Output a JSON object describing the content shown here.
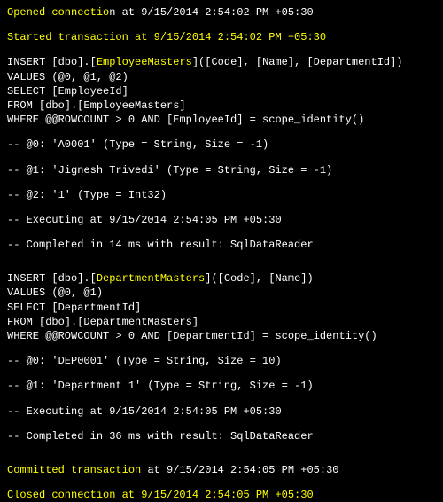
{
  "lines": {
    "opened_pre": "Opened connectio",
    "opened_rest": "n at 9/15/2014 2:54:02 PM +05:30",
    "started": "Started transaction at 9/15/2014 2:54:02 PM +05:30",
    "ins1_pre": "INSERT [dbo].[",
    "ins1_tbl": "EmployeeMasters",
    "ins1_post": "]([Code], [Name], [DepartmentId])",
    "values1": "VALUES (@0, @1, @2)",
    "select1": "SELECT [EmployeeId]",
    "from1": "FROM [dbo].[EmployeeMasters]",
    "where1": "WHERE @@ROWCOUNT > 0 AND [EmployeeId] = scope_identity()",
    "p0_1": "-- @0: 'A0001' (Type = String, Size = -1)",
    "p1_1": "-- @1: 'Jignesh Trivedi' (Type = String, Size = -1)",
    "p2_1": "-- @2: '1' (Type = Int32)",
    "exec1": "-- Executing at 9/15/2014 2:54:05 PM +05:30",
    "comp1": "-- Completed in 14 ms with result: SqlDataReader",
    "ins2_pre": "INSERT [dbo].[",
    "ins2_tbl": "DepartmentMasters",
    "ins2_post": "]([Code], [Name])",
    "values2": "VALUES (@0, @1)",
    "select2": "SELECT [DepartmentId]",
    "from2": "FROM [dbo].[DepartmentMasters]",
    "where2": "WHERE @@ROWCOUNT > 0 AND [DepartmentId] = scope_identity()",
    "p0_2": "-- @0: 'DEP0001' (Type = String, Size = 10)",
    "p1_2": "-- @1: 'Department 1' (Type = String, Size = -1)",
    "exec2": "-- Executing at 9/15/2014 2:54:05 PM +05:30",
    "comp2": "-- Completed in 36 ms with result: SqlDataReader",
    "committed_y": "Committed transaction ",
    "committed_w": "at 9/15/2014 2:54:05 PM +05:30",
    "closed": "Closed connection at 9/15/2014 2:54:05 PM +05:30"
  }
}
